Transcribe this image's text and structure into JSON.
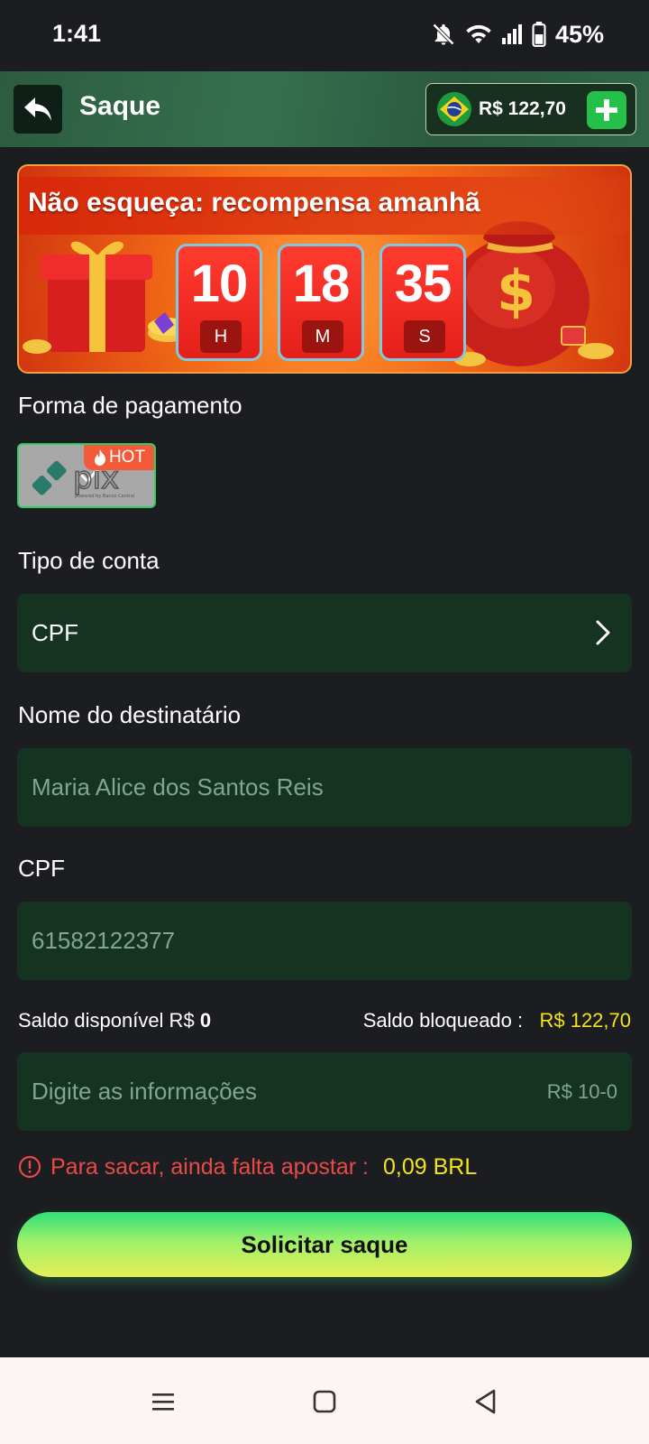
{
  "status_bar": {
    "time": "1:41",
    "battery": "45%",
    "icons": [
      "notifications-off-icon",
      "wifi-icon",
      "signal-icon",
      "battery-icon"
    ]
  },
  "header": {
    "title": "Saque",
    "balance": "R$ 122,70",
    "currency_flag": "brazil-flag-icon"
  },
  "banner": {
    "title": "Não esqueça: recompensa amanhã",
    "timer": [
      {
        "value": "10",
        "unit": "H"
      },
      {
        "value": "18",
        "unit": "M"
      },
      {
        "value": "35",
        "unit": "S"
      }
    ]
  },
  "form": {
    "payment_method_label": "Forma de pagamento",
    "payment_method": {
      "name": "pix",
      "badge": "HOT",
      "selected": true
    },
    "account_type_label": "Tipo de conta",
    "account_type_value": "CPF",
    "recipient_label": "Nome do destinatário",
    "recipient_value": "Maria Alice dos Santos Reis",
    "cpf_label": "CPF",
    "cpf_value": "61582122377",
    "available_label": "Saldo disponível R$",
    "available_value": "0",
    "blocked_label": "Saldo bloqueado :",
    "blocked_value": "R$ 122,70",
    "amount_placeholder": "Digite as informações",
    "amount_range": "R$ 10-0",
    "warning_text": "Para sacar, ainda falta apostar :",
    "warning_amount": "0,09 BRL",
    "submit_label": "Solicitar saque"
  },
  "colors": {
    "background": "#1c1d21",
    "field": "#163322",
    "accent_green": "#25c04a",
    "warning_red": "#e84a4a",
    "highlight_yellow": "#f2e41c"
  }
}
